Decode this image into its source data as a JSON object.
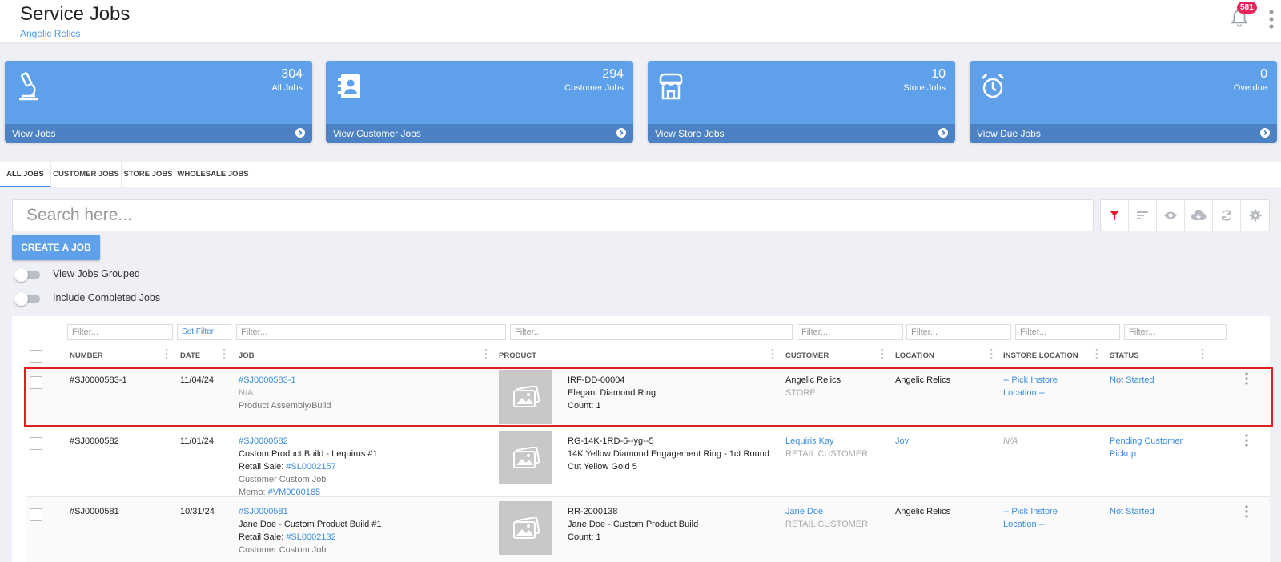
{
  "header": {
    "title": "Service Jobs",
    "subtitle": "Angelic Relics",
    "notification_count": "581"
  },
  "cards": [
    {
      "count": "304",
      "label": "All Jobs",
      "link": "View Jobs",
      "icon": "microscope-icon"
    },
    {
      "count": "294",
      "label": "Customer Jobs",
      "link": "View Customer Jobs",
      "icon": "contact-book-icon"
    },
    {
      "count": "10",
      "label": "Store Jobs",
      "link": "View Store Jobs",
      "icon": "store-icon"
    },
    {
      "count": "0",
      "label": "Overdue",
      "link": "View Due Jobs",
      "icon": "alarm-clock-icon"
    }
  ],
  "tabs": [
    "ALL JOBS",
    "CUSTOMER JOBS",
    "STORE JOBS",
    "WHOLESALE JOBS"
  ],
  "search": {
    "placeholder": "Search here..."
  },
  "toolbar_icons": [
    "filter-icon",
    "sort-icon",
    "eye-icon",
    "cloud-download-icon",
    "refresh-icon",
    "gear-icon"
  ],
  "create_button": "CREATE A JOB",
  "toggles": [
    {
      "label": "View Jobs Grouped",
      "on": false
    },
    {
      "label": "Include Completed Jobs",
      "on": false
    }
  ],
  "filters": {
    "placeholder": "Filter...",
    "set_filter": "Set Filter"
  },
  "columns": [
    "NUMBER",
    "DATE",
    "JOB",
    "PRODUCT",
    "CUSTOMER",
    "LOCATION",
    "INSTORE LOCATION",
    "STATUS"
  ],
  "rows": [
    {
      "number": "#SJ0000583-1",
      "date": "11/04/24",
      "job_link": "#SJ0000583-1",
      "job_line2": "N/A",
      "job_line3": "Product Assembly/Build",
      "product_sku": "IRF-DD-00004",
      "product_name": "Elegant Diamond Ring",
      "product_count": "Count: 1",
      "customer": "Angelic Relics",
      "customer_type": "STORE",
      "location": "Angelic Relics",
      "instore_1": "-- Pick Instore",
      "instore_2": "Location --",
      "status": "Not Started"
    },
    {
      "number": "#SJ0000582",
      "date": "11/01/24",
      "job_link": "#SJ0000582",
      "job_line2": "Custom Product Build - Lequirus #1",
      "retail_label": "Retail Sale: ",
      "retail_link": "#SL0002157",
      "job_line4": "Customer Custom Job",
      "memo_label": "Memo: ",
      "memo_link": "#VM0000165",
      "product_sku": "RG-14K-1RD-6--yg--5",
      "product_name_1": "14K Yellow Diamond Engagement Ring - 1ct Round",
      "product_name_2": "Cut Yellow Gold 5",
      "customer": "Lequiris Kay",
      "customer_type": "RETAIL CUSTOMER",
      "location": "Jov",
      "instore": "N/A",
      "status_1": "Pending Customer",
      "status_2": "Pickup"
    },
    {
      "number": "#SJ0000581",
      "date": "10/31/24",
      "job_link": "#SJ0000581",
      "job_line2": "Jane Doe - Custom Product Build #1",
      "retail_label": "Retail Sale: ",
      "retail_link": "#SL0002132",
      "job_line4": "Customer Custom Job",
      "product_sku": "RR-2000138",
      "product_name": "Jane Doe - Custom Product Build",
      "product_count": "Count: 1",
      "customer": "Jane Doe",
      "customer_type": "RETAIL CUSTOMER",
      "location": "Angelic Relics",
      "instore_1": "-- Pick Instore",
      "instore_2": "Location --",
      "status": "Not Started"
    }
  ],
  "colors": {
    "card_bg": "#5fa0eb",
    "card_footer": "#4c82c4",
    "link": "#3b8ee0",
    "badge": "#e8245a",
    "filter_active": "#e8182e",
    "selection_border": "#e02020"
  }
}
